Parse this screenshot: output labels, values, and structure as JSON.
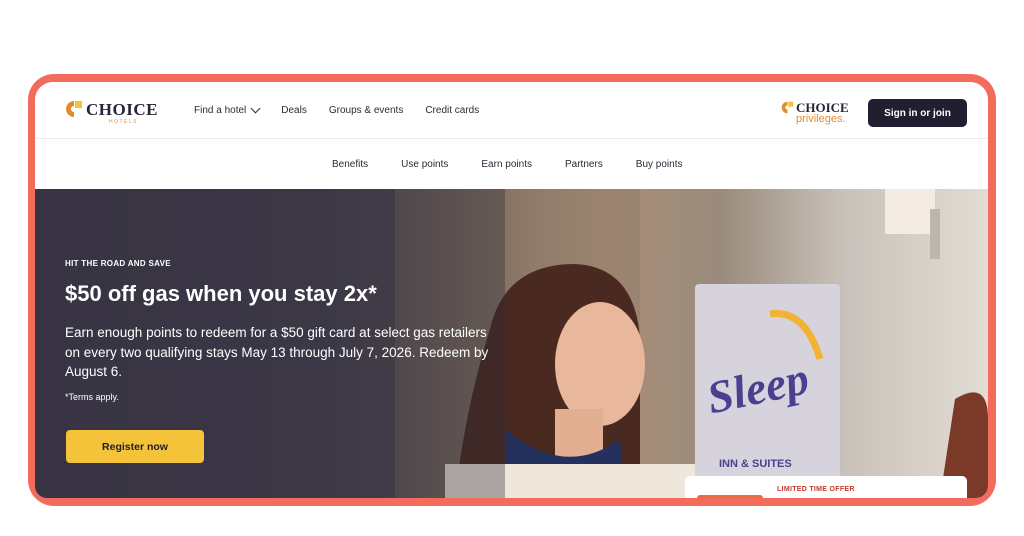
{
  "header": {
    "logo_text": "CHOICE",
    "logo_sub": "HOTELS",
    "nav": [
      {
        "label": "Find a hotel"
      },
      {
        "label": "Deals"
      },
      {
        "label": "Groups & events"
      },
      {
        "label": "Credit cards"
      }
    ],
    "privileges_logo": {
      "top": "CHOICE",
      "bottom": "privileges."
    },
    "signin_label": "Sign in or join"
  },
  "subnav": {
    "items": [
      "Benefits",
      "Use points",
      "Earn points",
      "Partners",
      "Buy points"
    ]
  },
  "hero": {
    "kicker": "HIT THE ROAD AND SAVE",
    "title": "$50 off gas when you stay 2x*",
    "body": "Earn enough points to redeem for a $50 gift card at select gas retailers on every two qualifying stays May 13 through July 7, 2026. Redeem by August 6.",
    "terms": "*Terms apply.",
    "cta_label": "Register now",
    "sign_text": "Sleep",
    "sign_sub": "INN & SUITES"
  },
  "offer_card": {
    "label": "LIMITED TIME OFFER"
  },
  "colors": {
    "frame": "#f26b5c",
    "brand_orange": "#e58b2f",
    "signin_bg": "#221d30",
    "cta_yellow": "#f4c33a"
  }
}
